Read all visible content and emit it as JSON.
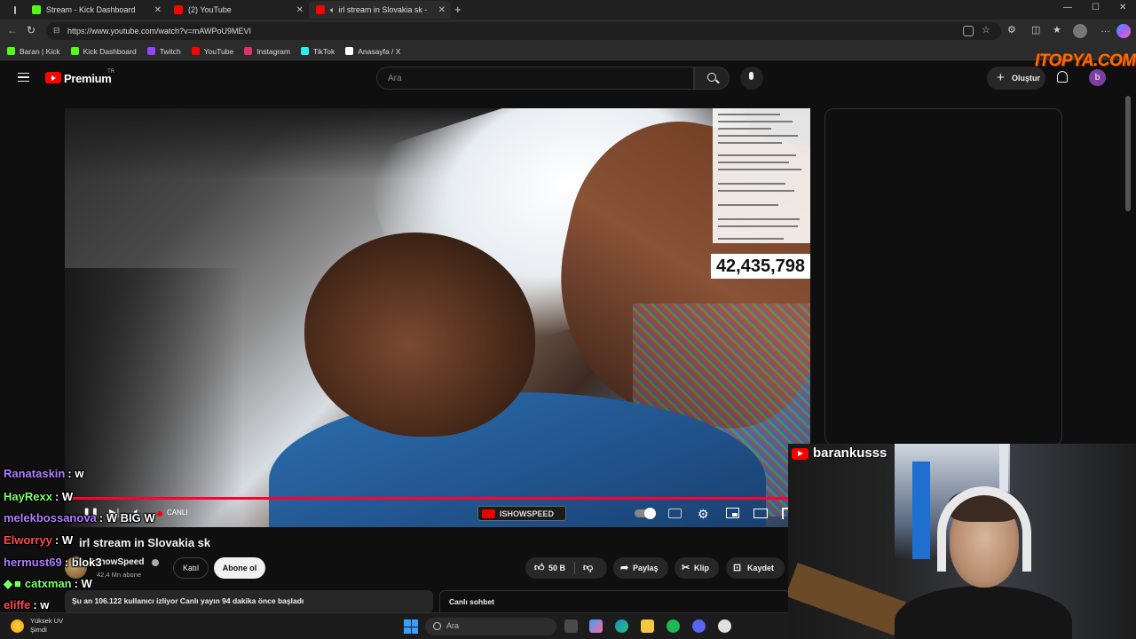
{
  "browser": {
    "tabs": [
      {
        "title": "Stream - Kick Dashboard",
        "favicon_color": "#53fc18",
        "active": false
      },
      {
        "title": "(2) YouTube",
        "favicon_color": "#ff0000",
        "active": false
      },
      {
        "title": "irl stream in Slovakia sk - You",
        "favicon_color": "#ff0000",
        "active": true
      }
    ],
    "url": "https://www.youtube.com/watch?v=mAWPoU9MEVI",
    "bookmarks": [
      {
        "label": "Baran | Kick",
        "color": "#53fc18"
      },
      {
        "label": "Kick Dashboard",
        "color": "#53fc18"
      },
      {
        "label": "Twitch",
        "color": "#9146ff"
      },
      {
        "label": "YouTube",
        "color": "#ff0000"
      },
      {
        "label": "Instagram",
        "color": "#e1306c"
      },
      {
        "label": "TikTok",
        "color": "#25f4ee"
      },
      {
        "label": "Anasayfa / X",
        "color": "#ffffff"
      }
    ]
  },
  "youtube": {
    "logo_text": "Premium",
    "region": "TR",
    "search_placeholder": "Ara",
    "create_label": "Oluştur",
    "avatar_letter": "b"
  },
  "overlay_brand": "ITOPYA.COM",
  "video": {
    "counter": "42,435,798",
    "live_label": "CANLI",
    "channel_watermark": "ISHOWSPEED",
    "title": "irl stream in Slovakia sk",
    "channel_name": "IShowSpeed",
    "subscribers": "42,4 Mn abone",
    "join_label": "Katıl",
    "subscribe_label": "Abone ol",
    "likes": "50 B",
    "share_label": "Paylaş",
    "clip_label": "Klip",
    "save_label": "Kaydet",
    "viewers_text": "Şu an 106.122 kullanıcı izliyor  Canlı yayın 94 dakika önce başladı",
    "live_chat_label": "Canlı sohbet"
  },
  "stream_chat": [
    {
      "user": "Ranataskin",
      "msg": ": w",
      "color": "#b07cff"
    },
    {
      "user": "HayRexx",
      "msg": ": W",
      "color": "#7cff6b"
    },
    {
      "user": "melekbossanova",
      "msg": ": W BIG W",
      "color": "#b07cff"
    },
    {
      "user": "Elworryy",
      "msg": ": W",
      "color": "#ff4a4a"
    },
    {
      "user": "hermust69",
      "msg": ": blok3",
      "color": "#b07cff"
    },
    {
      "user": "catxman",
      "msg": ": W",
      "color": "#7cff6b"
    },
    {
      "user": "eliffe",
      "msg": ": w",
      "color": "#ff4a4a"
    }
  ],
  "webcam": {
    "streamer_name": "barankusss"
  },
  "taskbar": {
    "weather_line1": "Yüksek UV",
    "weather_line2": "Şimdi",
    "search_placeholder": "Ara"
  }
}
